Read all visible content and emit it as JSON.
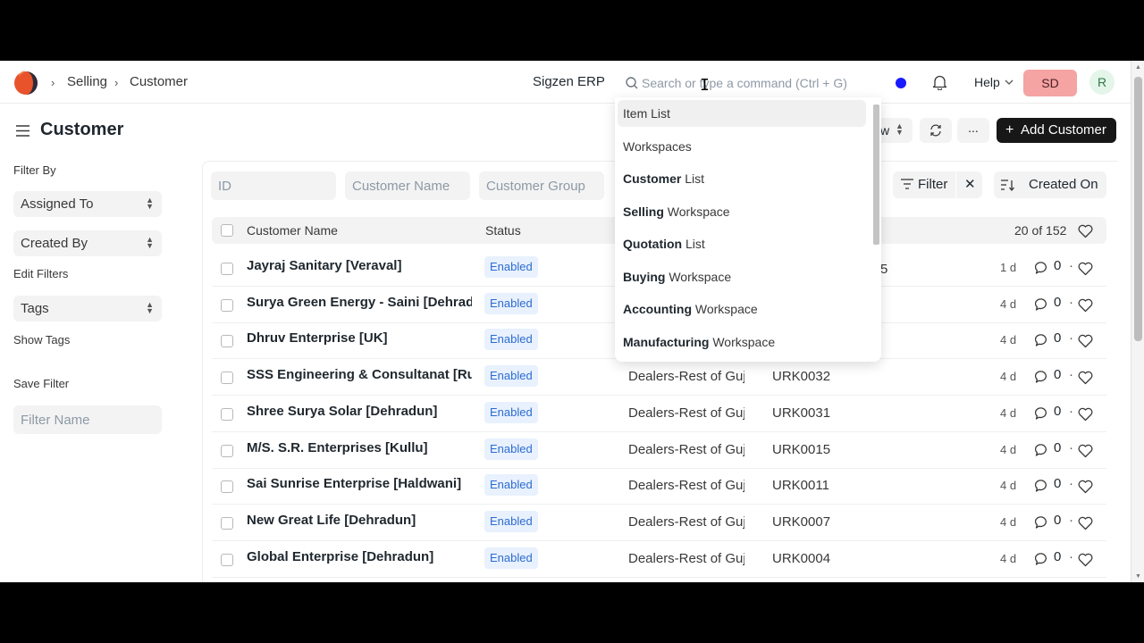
{
  "navbar": {
    "breadcrumbs": [
      "Selling",
      "Customer"
    ],
    "brand": "Sigzen ERP",
    "search_placeholder": "Search or type a command (Ctrl + G)",
    "help_label": "Help",
    "user_button": "SD",
    "avatar_letter": "R",
    "status_dot_color": "#1a1aff"
  },
  "page": {
    "title": "Customer",
    "add_button": "Add Customer",
    "sort_partial": "w",
    "more_label": "..."
  },
  "sidebar": {
    "filter_by": "Filter By",
    "assigned_to": "Assigned To",
    "created_by": "Created By",
    "edit_filters": "Edit Filters",
    "tags": "Tags",
    "show_tags": "Show Tags",
    "save_filter": "Save Filter",
    "filter_name_placeholder": "Filter Name"
  },
  "filters": {
    "id_placeholder": "ID",
    "customer_name_placeholder": "Customer Name",
    "customer_group_placeholder": "Customer Group",
    "filter_label": "Filter",
    "sort_label": "Created On"
  },
  "table": {
    "col_name": "Customer Name",
    "col_status": "Status",
    "count": "20 of 152",
    "first_row_partial": "5",
    "rows": [
      {
        "name": "Jayraj Sanitary [Veraval]",
        "status": "Enabled",
        "group": "",
        "code": "",
        "age": "1 d",
        "comments": "0"
      },
      {
        "name": "Surya Green Energy - Saini [Dehradun]",
        "status": "Enabled",
        "group": "",
        "code": "",
        "age": "4 d",
        "comments": "0"
      },
      {
        "name": "Dhruv Enterprise [UK]",
        "status": "Enabled",
        "group": "",
        "code": "",
        "age": "4 d",
        "comments": "0"
      },
      {
        "name": "SSS Engineering & Consultanat [Rudr",
        "status": "Enabled",
        "group": "Dealers-Rest of Guj",
        "code": "URK0032",
        "age": "4 d",
        "comments": "0"
      },
      {
        "name": "Shree Surya Solar [Dehradun]",
        "status": "Enabled",
        "group": "Dealers-Rest of Guj",
        "code": "URK0031",
        "age": "4 d",
        "comments": "0"
      },
      {
        "name": "M/S. S.R. Enterprises [Kullu]",
        "status": "Enabled",
        "group": "Dealers-Rest of Guj",
        "code": "URK0015",
        "age": "4 d",
        "comments": "0"
      },
      {
        "name": "Sai Sunrise Enterprise [Haldwani]",
        "status": "Enabled",
        "group": "Dealers-Rest of Guj",
        "code": "URK0011",
        "age": "4 d",
        "comments": "0"
      },
      {
        "name": "New Great Life [Dehradun]",
        "status": "Enabled",
        "group": "Dealers-Rest of Guj",
        "code": "URK0007",
        "age": "4 d",
        "comments": "0"
      },
      {
        "name": "Global Enterprise [Dehradun]",
        "status": "Enabled",
        "group": "Dealers-Rest of Guj",
        "code": "URK0004",
        "age": "4 d",
        "comments": "0"
      }
    ]
  },
  "dropdown": {
    "items": [
      {
        "bold": "",
        "rest": "Item List"
      },
      {
        "bold": "",
        "rest": "Workspaces"
      },
      {
        "bold": "Customer",
        "rest": " List"
      },
      {
        "bold": "Selling",
        "rest": " Workspace"
      },
      {
        "bold": "Quotation",
        "rest": " List"
      },
      {
        "bold": "Buying",
        "rest": " Workspace"
      },
      {
        "bold": "Accounting",
        "rest": " Workspace"
      },
      {
        "bold": "Manufacturing",
        "rest": " Workspace"
      }
    ]
  }
}
